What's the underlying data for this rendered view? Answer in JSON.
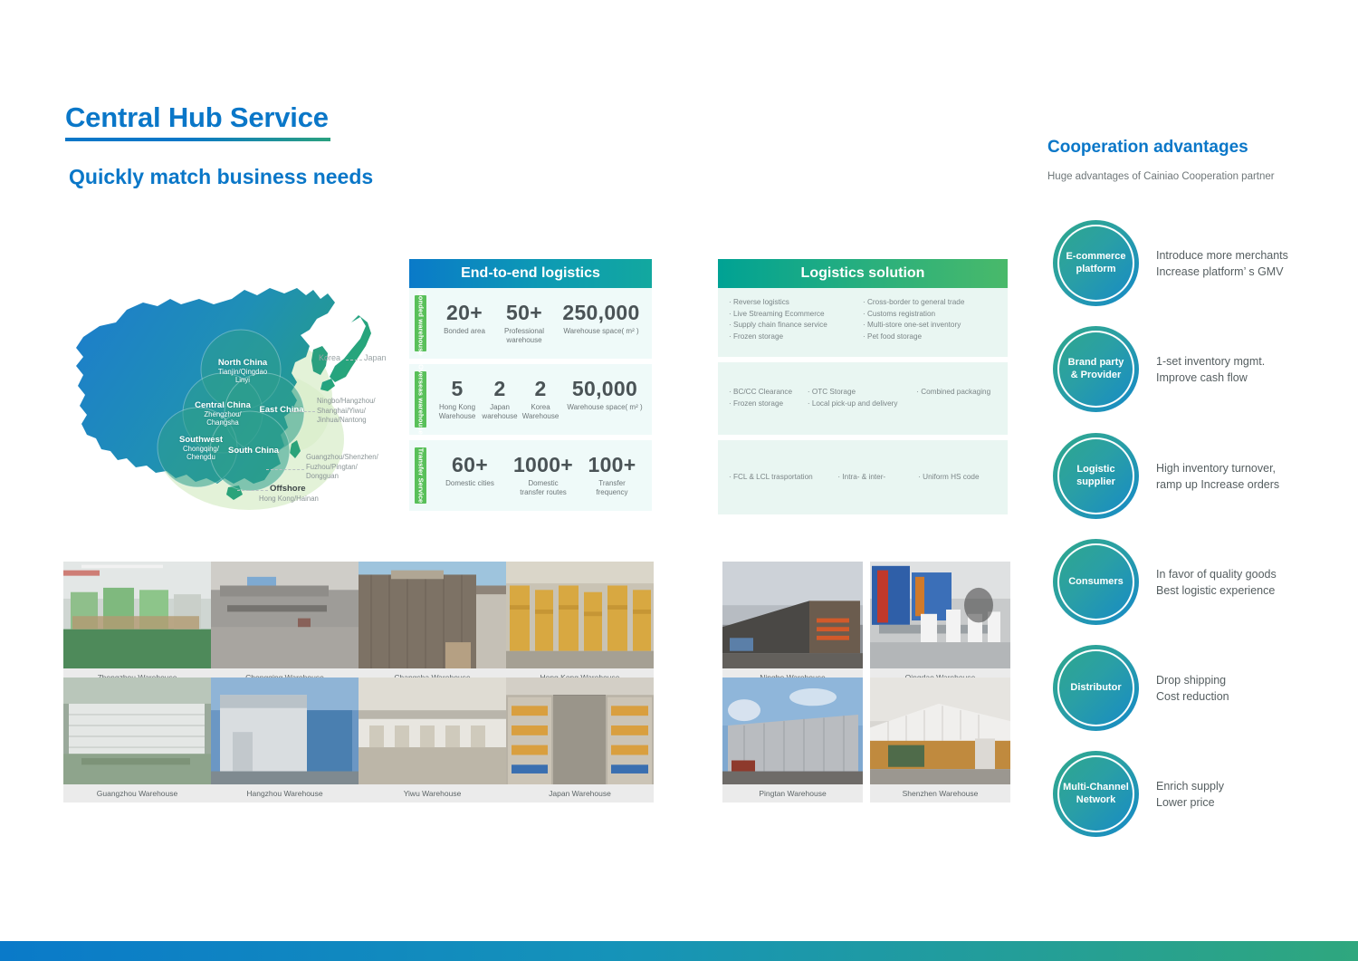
{
  "header": {
    "title": "Central Hub Service",
    "subtitle": "Quickly match business needs"
  },
  "map": {
    "regions": [
      {
        "name": "North China",
        "cities": "Tianjin/Qingdao\nLinyi"
      },
      {
        "name": "Central China",
        "cities": "Zhengzhou/\nChangsha"
      },
      {
        "name": "East China",
        "cities": ""
      },
      {
        "name": "Southwest",
        "cities": "Chongqing/\nChengdu"
      },
      {
        "name": "South China",
        "cities": ""
      }
    ],
    "offshore": {
      "name": "Offshore",
      "cities": "Hong Kong/Hainan"
    },
    "countries": [
      "Korea",
      "Japan"
    ],
    "notes": [
      "Ningbo/Hangzhou/\nShanghai/Yiwu/\nJinhua/Nantong",
      "Guangzhou/Shenzhen/\nFuzhou/Pingtan/\nDongguan"
    ]
  },
  "e2e": {
    "header": "End-to-end logistics",
    "rows": [
      {
        "tab": "Bonded warehouse",
        "stats": [
          {
            "num": "20+",
            "label": "Bonded area"
          },
          {
            "num": "50+",
            "label": "Professional\nwarehouse"
          },
          {
            "num": "250,000",
            "label": "Warehouse space( m² )"
          }
        ]
      },
      {
        "tab": "Overseas warehouse",
        "stats": [
          {
            "num": "5",
            "label": "Hong Kong\nWarehouse"
          },
          {
            "num": "2",
            "label": "Japan\nwarehouse"
          },
          {
            "num": "2",
            "label": "Korea\nWarehouse"
          },
          {
            "num": "50,000",
            "label": "Warehouse space( m² )"
          }
        ]
      },
      {
        "tab": "Transfer Service",
        "stats": [
          {
            "num": "60+",
            "label": "Domestic cities"
          },
          {
            "num": "1000+",
            "label": "Domestic\ntransfer routes"
          },
          {
            "num": "100+",
            "label": "Transfer\nfrequency"
          }
        ]
      }
    ]
  },
  "logistics_solution": {
    "header": "Logistics solution",
    "rows": [
      {
        "columns": [
          [
            "· Reverse logistics",
            "· Live Streaming Ecommerce",
            "· Supply chain finance service",
            "· Frozen storage"
          ],
          [
            "· Cross-border to general trade",
            "· Customs registration",
            "· Multi-store one-set inventory",
            "· Pet food storage"
          ]
        ]
      },
      {
        "columns": [
          [
            "· BC/CC Clearance",
            "· Frozen storage"
          ],
          [
            "· OTC Storage",
            "· Local pick-up and delivery"
          ],
          [
            "· Combined packaging"
          ]
        ]
      },
      {
        "columns": [
          [
            "· FCL & LCL trasportation"
          ],
          [
            "· Intra- & inter-"
          ],
          [
            "· Uniform HS code"
          ]
        ]
      }
    ]
  },
  "gallery_left": [
    {
      "caption": "Zhengzhou Warehouse",
      "scene": "interior-green"
    },
    {
      "caption": "Chongqing Warehouse",
      "scene": "facility-gray"
    },
    {
      "caption": "Changsha Warehouse",
      "scene": "building-brown"
    },
    {
      "caption": "Hong Kong Warehouse",
      "scene": "racks-yellow"
    },
    {
      "caption": "Guangzhou Warehouse",
      "scene": "aerial-white"
    },
    {
      "caption": "Hangzhou Warehouse",
      "scene": "building-blue"
    },
    {
      "caption": "Yiwu Warehouse",
      "scene": "building-long"
    },
    {
      "caption": "Japan Warehouse",
      "scene": "racks-interior"
    }
  ],
  "gallery_right": [
    {
      "caption": "Ningbo Warehouse",
      "scene": "dusk-facility"
    },
    {
      "caption": "Qingdao Warehouse",
      "scene": "expo-people"
    },
    {
      "caption": "Pingtan Warehouse",
      "scene": "sky-building"
    },
    {
      "caption": "Shenzhen Warehouse",
      "scene": "white-roof"
    }
  ],
  "cooperation": {
    "title": "Cooperation advantages",
    "subtitle": "Huge advantages of Cainiao Cooperation partner",
    "items": [
      {
        "label": "E-commerce\nplatform",
        "text": "Introduce more merchants\nIncrease platform’ s GMV"
      },
      {
        "label": "Brand party\n& Provider",
        "text": "1-set inventory mgmt.\nImprove cash flow"
      },
      {
        "label": "Logistic\nsupplier",
        "text": "High inventory turnover,\nramp up Increase orders"
      },
      {
        "label": "Consumers",
        "text": "In favor of quality goods\nBest logistic experience"
      },
      {
        "label": "Distributor",
        "text": "Drop shipping\nCost reduction"
      },
      {
        "label": "Multi-Channel\nNetwork",
        "text": "Enrich supply\nLower price"
      }
    ]
  },
  "colors": {
    "brand_blue": "#0a77c8",
    "brand_green": "#2aa17f",
    "tab_green": "#59c05a",
    "panel_blue_bg": "#effaf9",
    "panel_green_bg": "#e9f6f2"
  }
}
